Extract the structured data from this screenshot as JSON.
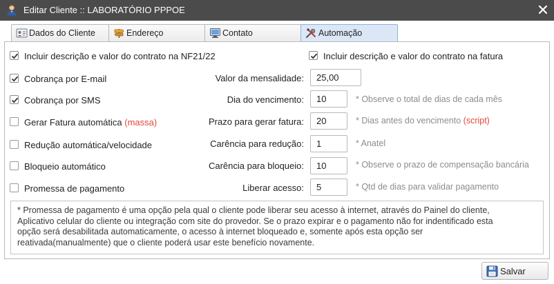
{
  "window": {
    "title": "Editar Cliente :: LABORATÓRIO PPPOE",
    "icon": "user-icon",
    "close_icon": "close-icon"
  },
  "tabs": [
    {
      "label": "Dados do Cliente",
      "icon": "client-card-icon",
      "active": false
    },
    {
      "label": "Endereço",
      "icon": "signpost-icon",
      "active": false
    },
    {
      "label": "Contato",
      "icon": "monitor-icon",
      "active": false
    },
    {
      "label": "Automação",
      "icon": "tools-icon",
      "active": true
    }
  ],
  "automation": {
    "nf_checkbox": {
      "label": "Incluir descrição e valor do contrato na NF21/22",
      "checked": true
    },
    "fatura_checkbox": {
      "label": "Incluir descrição e valor do contrato na fatura",
      "checked": true
    },
    "email_checkbox": {
      "label": "Cobrança por E-mail",
      "checked": true
    },
    "sms_checkbox": {
      "label": "Cobrança por SMS",
      "checked": true
    },
    "fatura_auto_checkbox": {
      "label": "Gerar Fatura automática",
      "suffix": "(massa)",
      "checked": false
    },
    "reducao_checkbox": {
      "label": "Redução automática/velocidade",
      "checked": false
    },
    "bloqueio_checkbox": {
      "label": "Bloqueio automático",
      "checked": false
    },
    "promessa_checkbox": {
      "label": "Promessa de pagamento",
      "checked": false
    },
    "mensalidade": {
      "label": "Valor da mensalidade:",
      "value": "25,00"
    },
    "vencimento": {
      "label": "Dia do vencimento:",
      "value": "10",
      "hint": "* Observe o total de dias de cada mês"
    },
    "prazo": {
      "label": "Prazo para gerar fatura:",
      "value": "20",
      "hint": "* Dias antes do vencimento",
      "hint_suffix": "(script)"
    },
    "carencia_reducao": {
      "label": "Carência para redução:",
      "value": "1",
      "hint": "* Anatel"
    },
    "carencia_bloqueio": {
      "label": "Carência para bloqueio:",
      "value": "10",
      "hint": "* Observe o prazo de compensação bancária"
    },
    "liberar": {
      "label": "Liberar acesso:",
      "value": "5",
      "hint": "* Qtd de dias para validar pagamento"
    }
  },
  "note": {
    "line1": "* Promessa de pagamento é uma opção pela qual o cliente pode liberar seu acesso à internet, através do Painel do cliente,",
    "line2": "Aplicativo celular do cliente ou integração com site do provedor. Se o prazo expirar e o pagamento não for indentificado esta",
    "line3": "opção será desabilitada automaticamente, o acesso à internet bloqueado e, somente após esta opção ser",
    "line4": "reativada(manualmente) que o cliente poderá usar este benefício novamente."
  },
  "footer": {
    "save_label": "Salvar",
    "save_icon": "floppy-disk-icon"
  },
  "colors": {
    "titlebar": "#4b4b4b",
    "active_tab": "#dbe7f7",
    "accent_red": "#e0473a",
    "hint_gray": "#8c8c8c"
  }
}
